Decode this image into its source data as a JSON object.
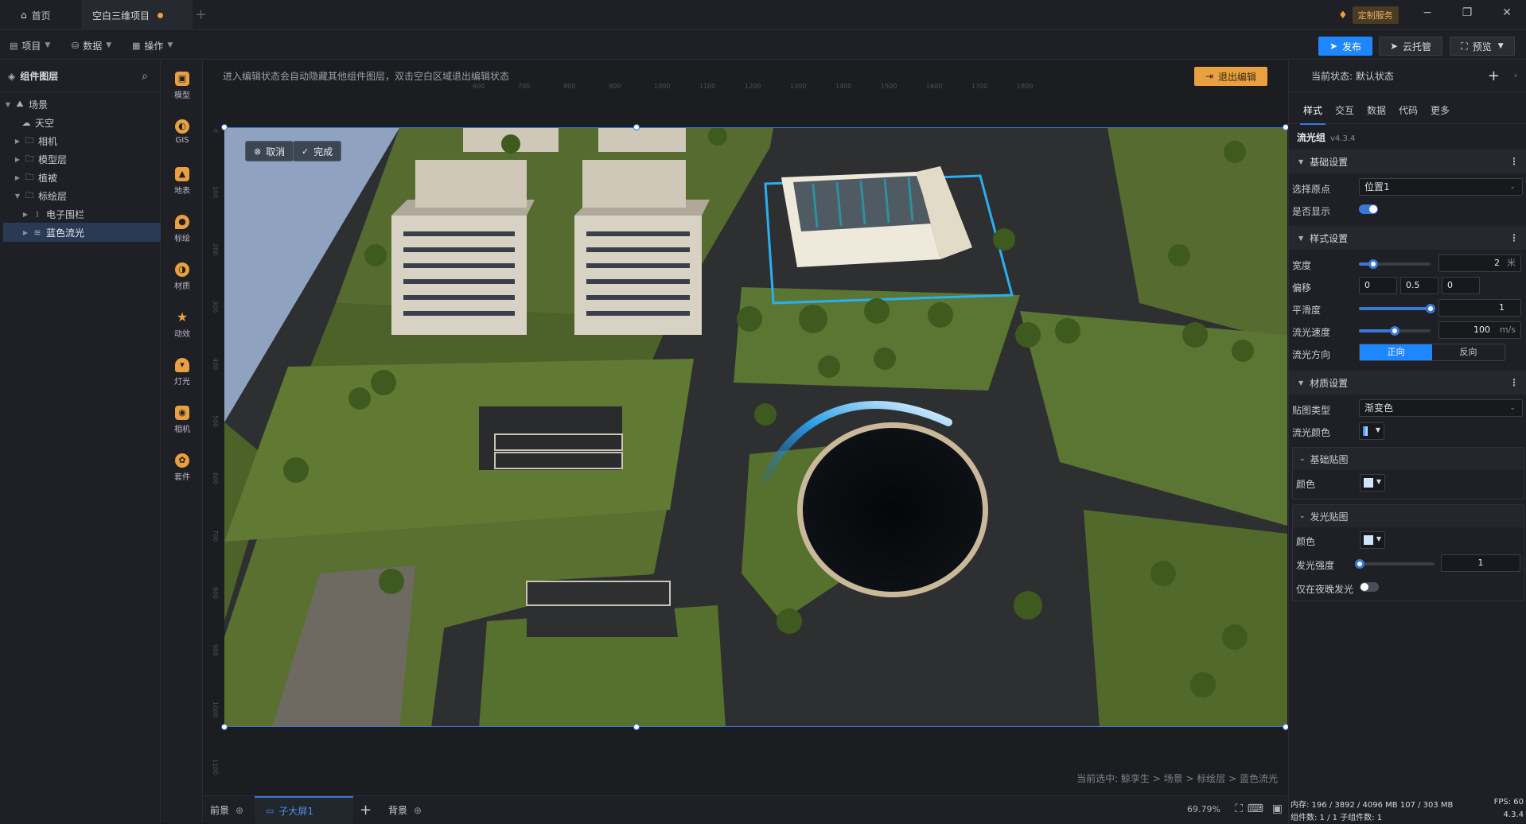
{
  "titlebar": {
    "tabs": [
      {
        "label": "首页"
      },
      {
        "label": "空白三维项目"
      }
    ],
    "service_button": "定制服务"
  },
  "toolbar": {
    "menus": [
      {
        "label": "项目"
      },
      {
        "label": "数据"
      },
      {
        "label": "操作"
      }
    ],
    "publish": "发布",
    "cloud": "云托管",
    "preview": "预览"
  },
  "left_panel": {
    "title": "组件图层",
    "tree": [
      {
        "label": "场景"
      },
      {
        "label": "天空"
      },
      {
        "label": "相机"
      },
      {
        "label": "模型层"
      },
      {
        "label": "植被"
      },
      {
        "label": "标绘层"
      },
      {
        "label": "电子围栏"
      },
      {
        "label": "蓝色流光"
      }
    ]
  },
  "rail": [
    {
      "label": "模型",
      "color": "#e8a040"
    },
    {
      "label": "GIS",
      "color": "#e8a040"
    },
    {
      "label": "地表",
      "color": "#e8a040"
    },
    {
      "label": "标绘",
      "color": "#e8a040"
    },
    {
      "label": "材质",
      "color": "#e8a040"
    },
    {
      "label": "动效",
      "color": "#e8a040"
    },
    {
      "label": "灯光",
      "color": "#e8a040"
    },
    {
      "label": "相机",
      "color": "#e8a040"
    },
    {
      "label": "套件",
      "color": "#e8a040"
    }
  ],
  "canvas": {
    "notice": "进入编辑状态会自动隐藏其他组件图层，双击空白区域退出编辑状态",
    "exit_edit": "退出编辑",
    "cancel": "取消",
    "done": "完成",
    "ruler_top": [
      "600",
      "700",
      "800",
      "900",
      "1000",
      "1100",
      "1200",
      "1300",
      "1400",
      "1500",
      "1600",
      "1700",
      "1800"
    ],
    "ruler_left": [
      "0",
      "100",
      "200",
      "300",
      "400",
      "500",
      "600",
      "700",
      "800",
      "900",
      "1000",
      "1100"
    ],
    "breadcrumb": "当前选中: 鲸孪生 > 场景 > 标绘层 > 蓝色流光"
  },
  "bottombar": {
    "tabs": [
      {
        "label": "前景"
      },
      {
        "label": "子大屏1"
      },
      {
        "label": "背景"
      }
    ],
    "zoom": "69.79%"
  },
  "right_panel": {
    "state": "当前状态: 默认状态",
    "tabs": [
      {
        "label": "样式"
      },
      {
        "label": "交互"
      },
      {
        "label": "数据"
      },
      {
        "label": "代码"
      },
      {
        "label": "更多"
      }
    ],
    "component": "流光组",
    "version": "v4.3.4",
    "basic": {
      "title": "基础设置",
      "origin_label": "选择原点",
      "origin_value": "位置1",
      "visible_label": "是否显示",
      "visible": true
    },
    "style": {
      "title": "样式设置",
      "width_label": "宽度",
      "width_value": "2",
      "width_unit": "米",
      "width_fraction": 0.2,
      "offset_label": "偏移",
      "offset": [
        "0",
        "0.5",
        "0"
      ],
      "smooth_label": "平滑度",
      "smooth_value": "1",
      "smooth_fraction": 1.0,
      "speed_label": "流光速度",
      "speed_value": "100",
      "speed_unit": "m/s",
      "speed_fraction": 0.5,
      "direction_label": "流光方向",
      "direction_options": [
        "正向",
        "反向"
      ],
      "direction_selected": "正向"
    },
    "material": {
      "title": "材质设置",
      "map_type_label": "贴图类型",
      "map_type_value": "渐变色",
      "flow_color_label": "流光颜色",
      "base_map": {
        "title": "基础贴图",
        "color_label": "颜色",
        "color": "#cfe3ff"
      },
      "glow_map": {
        "title": "发光贴图",
        "color_label": "颜色",
        "color": "#cfe3ff",
        "intensity_label": "发光强度",
        "intensity_value": "1",
        "intensity_fraction": 0.0,
        "night_label": "仅在夜晚发光",
        "night": false
      }
    },
    "status": {
      "memory": "内存: 196 / 3892 / 4096 MB 107 / 303 MB",
      "fps": "FPS: 60",
      "components": "组件数: 1 / 1  子组件数: 1",
      "version": "4.3.4"
    }
  }
}
